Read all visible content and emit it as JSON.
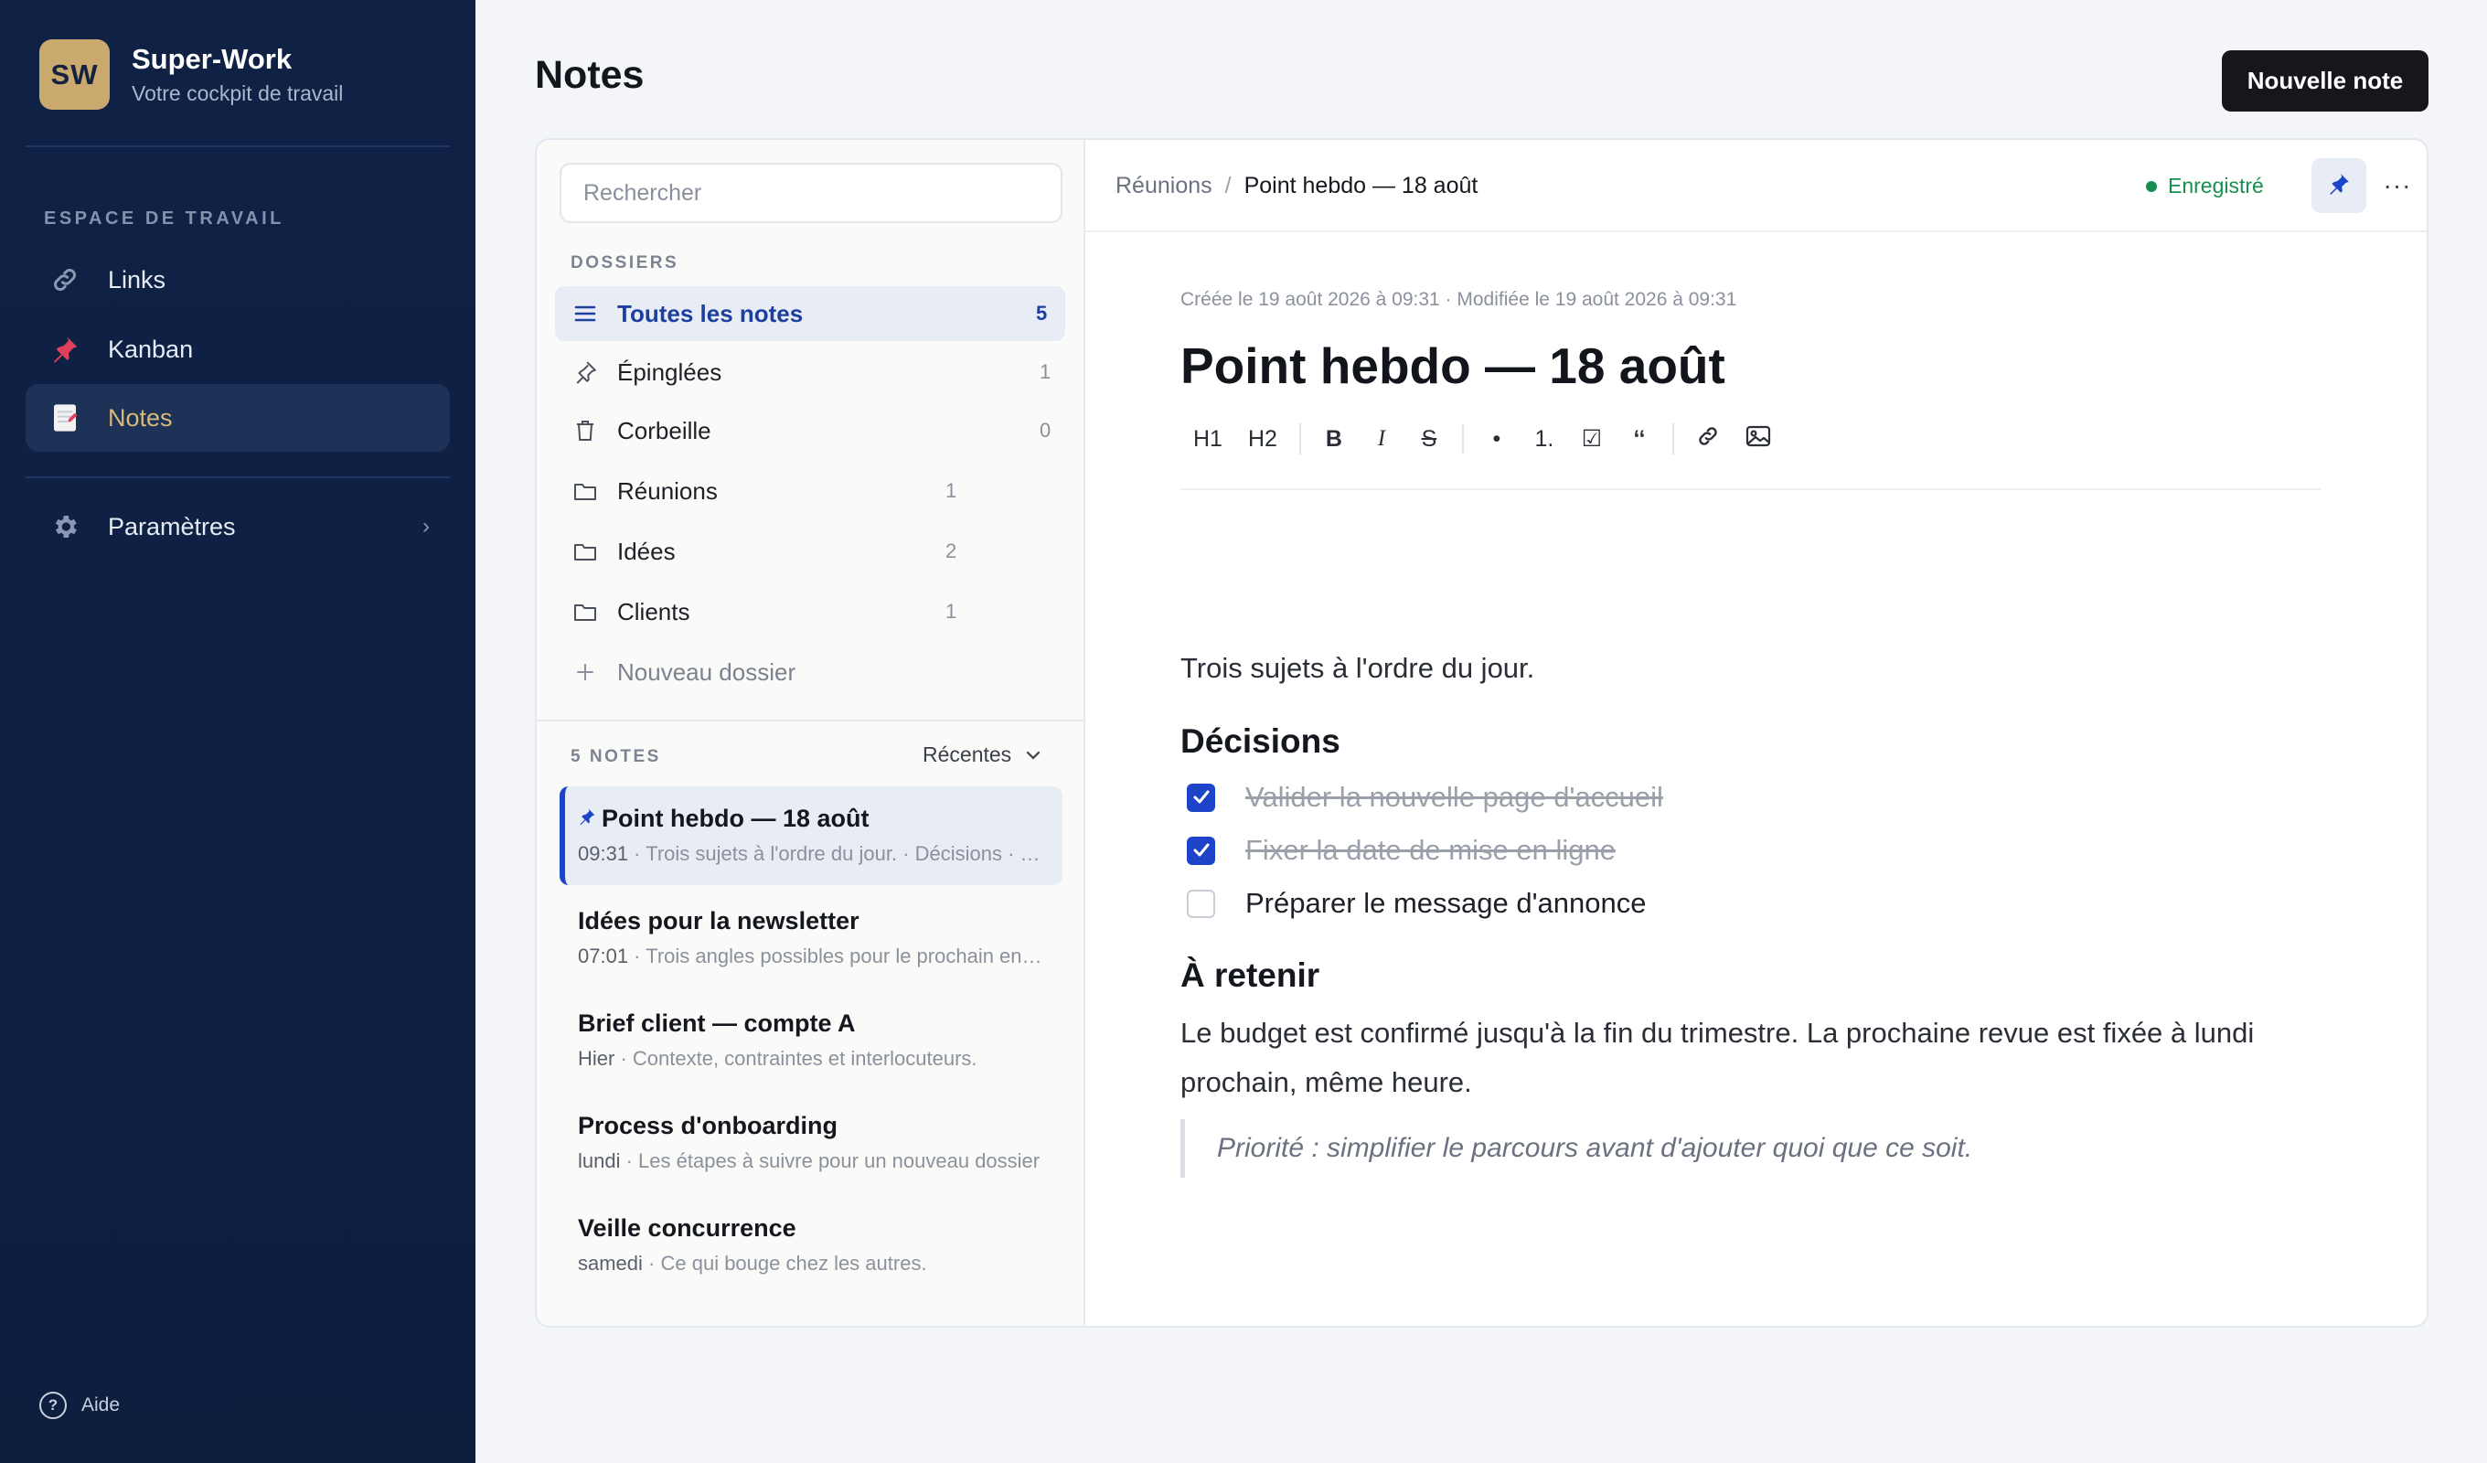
{
  "brand": {
    "initials": "SW",
    "name": "Super-Work",
    "tagline": "Votre cockpit de travail"
  },
  "sidebar": {
    "section_label": "ESPACE DE TRAVAIL",
    "items": [
      {
        "label": "Links",
        "icon": "link-icon",
        "active": false
      },
      {
        "label": "Kanban",
        "icon": "pushpin-icon",
        "active": true,
        "current": false
      },
      {
        "label": "Notes",
        "icon": "memo-icon",
        "active": true
      },
      {
        "label": "Paramètres",
        "icon": "gear-icon",
        "active": false
      }
    ],
    "help_label": "Aide",
    "help_icon_char": "?"
  },
  "header": {
    "title": "Notes",
    "new_note_label": "Nouvelle note"
  },
  "panel": {
    "search_placeholder": "Rechercher",
    "folders_label": "DOSSIERS",
    "folders": [
      {
        "label": "Toutes les notes",
        "count": "5",
        "icon": "list-icon"
      },
      {
        "label": "Épinglées",
        "count": "1",
        "icon": "pin-icon"
      },
      {
        "label": "Corbeille",
        "count": "0",
        "icon": "trash-icon"
      },
      {
        "label": "Réunions",
        "count": "1",
        "icon": "folder-icon"
      },
      {
        "label": "Idées",
        "count": "2",
        "icon": "folder-icon"
      },
      {
        "label": "Clients",
        "count": "1",
        "icon": "folder-icon"
      }
    ],
    "new_folder_label": "Nouveau dossier",
    "notes_count_label": "5 NOTES",
    "sort_label": "Récentes",
    "notes": [
      {
        "title": "Point hebdo — 18 août",
        "time": "09:31",
        "snippet": "Trois sujets à l'ordre du jour. · Décisions · Valider la nouvelle page d'accueil",
        "pinned": true
      },
      {
        "title": "Idées pour la newsletter",
        "time": "07:01",
        "snippet": "Trois angles possibles pour le prochain envoi"
      },
      {
        "title": "Brief client — compte A",
        "time": "Hier",
        "snippet": "Contexte, contraintes et interlocuteurs."
      },
      {
        "title": "Process d'onboarding",
        "time": "lundi",
        "snippet": "Les étapes à suivre pour un nouveau dossier"
      },
      {
        "title": "Veille concurrence",
        "time": "samedi",
        "snippet": "Ce qui bouge chez les autres."
      }
    ]
  },
  "editor": {
    "breadcrumb_parent": "Réunions",
    "breadcrumb_sep": "/",
    "breadcrumb_current": "Point hebdo — 18 août",
    "saved_label": "Enregistré",
    "more_label": "···",
    "meta": "Créée le 19 août 2026 à 09:31 · Modifiée le 19 août 2026 à 09:31",
    "title": "Point hebdo — 18 août",
    "toolbar": {
      "h1": "H1",
      "h2": "H2",
      "bold": "B",
      "italic": "I",
      "strike": "S",
      "bullet": "•",
      "numbered": "1.",
      "checklist": "☑",
      "quote": "‘‘"
    },
    "intro": "Trois sujets à l'ordre du jour.",
    "heading_decisions": "Décisions",
    "tasks": [
      {
        "text": "Valider la nouvelle page d'accueil",
        "done": true
      },
      {
        "text": "Fixer la date de mise en ligne",
        "done": true
      },
      {
        "text": "Préparer le message d'annonce",
        "done": false
      }
    ],
    "heading_retain": "À retenir",
    "paragraph_line1": "Le budget est confirmé jusqu'à la fin du trimestre. La prochaine revue est fixée à lundi",
    "paragraph_line2": "prochain, même heure.",
    "quote": "Priorité : simplifier le parcours avant d'ajouter quoi que ce soit."
  },
  "colors": {
    "sidebar_bg": "#0f2246",
    "accent_gold": "#d9b978",
    "accent_blue": "#1d44c8",
    "saved_green": "#15904f"
  }
}
